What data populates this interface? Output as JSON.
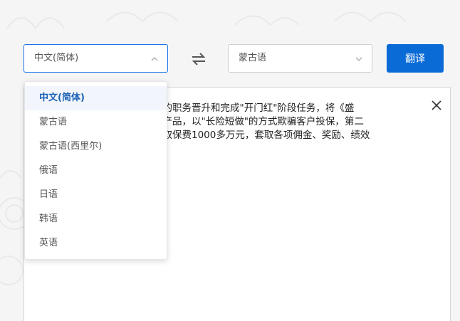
{
  "source_language": {
    "selected": "中文(简体)",
    "icon": "chevron-up-icon"
  },
  "target_language": {
    "selected": "蒙古语",
    "icon": "chevron-down-icon"
  },
  "swap": {
    "icon": "swap-arrows-icon"
  },
  "translate_button": {
    "label": "翻译"
  },
  "input_text": {
    "line1": "己的职务晋升和完成\"开门红\"阶段任务，将《盛",
    "line2": "售产品，以\"长险短做\"的方式欺骗客户投保，第二",
    "line3": "攻取保费1000多万元，套取各项佣金、奖励、绩效"
  },
  "close": {
    "icon": "close-icon"
  },
  "dropdown": {
    "items": [
      {
        "label": "中文(简体)",
        "active": true
      },
      {
        "label": "蒙古语"
      },
      {
        "label": "蒙古语(西里尔)"
      },
      {
        "label": "俄语"
      },
      {
        "label": "日语"
      },
      {
        "label": "韩语"
      },
      {
        "label": "英语"
      }
    ]
  },
  "colors": {
    "accent": "#0b6bd6",
    "active_item_bg": "#f2f6fc",
    "active_item_text": "#1a5fb4"
  }
}
